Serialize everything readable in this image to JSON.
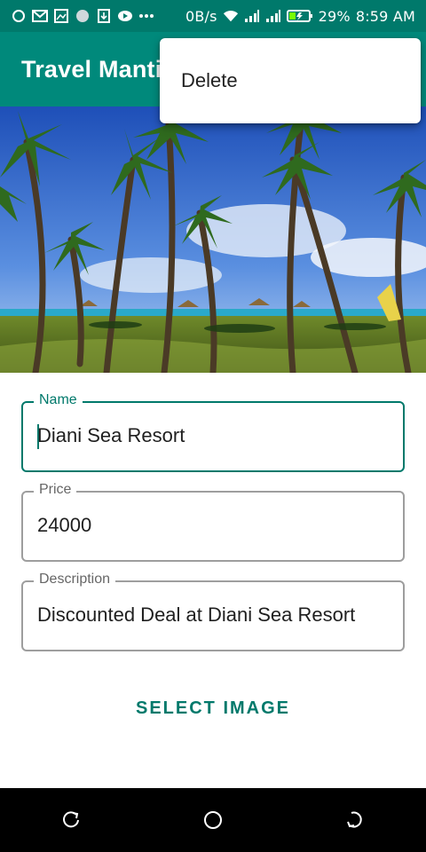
{
  "status_bar": {
    "net_speed": "0B/s",
    "battery_percent": "29%",
    "time": "8:59 AM",
    "icons": [
      "circle-icon",
      "gmail-icon",
      "image-icon",
      "dot-circle-icon",
      "download-icon",
      "play-icon",
      "more-icon",
      "wifi-icon",
      "signal-icon",
      "signal-icon",
      "battery-charging-icon"
    ]
  },
  "app_bar": {
    "title": "Travel Mantics"
  },
  "popup_menu": {
    "items": [
      {
        "label": "Delete"
      }
    ]
  },
  "form": {
    "name": {
      "label": "Name",
      "value": "Diani Sea Resort"
    },
    "price": {
      "label": "Price",
      "value": "24000"
    },
    "description": {
      "label": "Description",
      "value": "Discounted Deal at Diani Sea Resort"
    }
  },
  "select_image_button": "SELECT IMAGE",
  "colors": {
    "primary": "#00897b",
    "primary_dark": "#00796b",
    "accent": "#00796b"
  },
  "nav_bar": {
    "icons": [
      "recent-apps-icon",
      "home-icon",
      "back-icon"
    ]
  }
}
